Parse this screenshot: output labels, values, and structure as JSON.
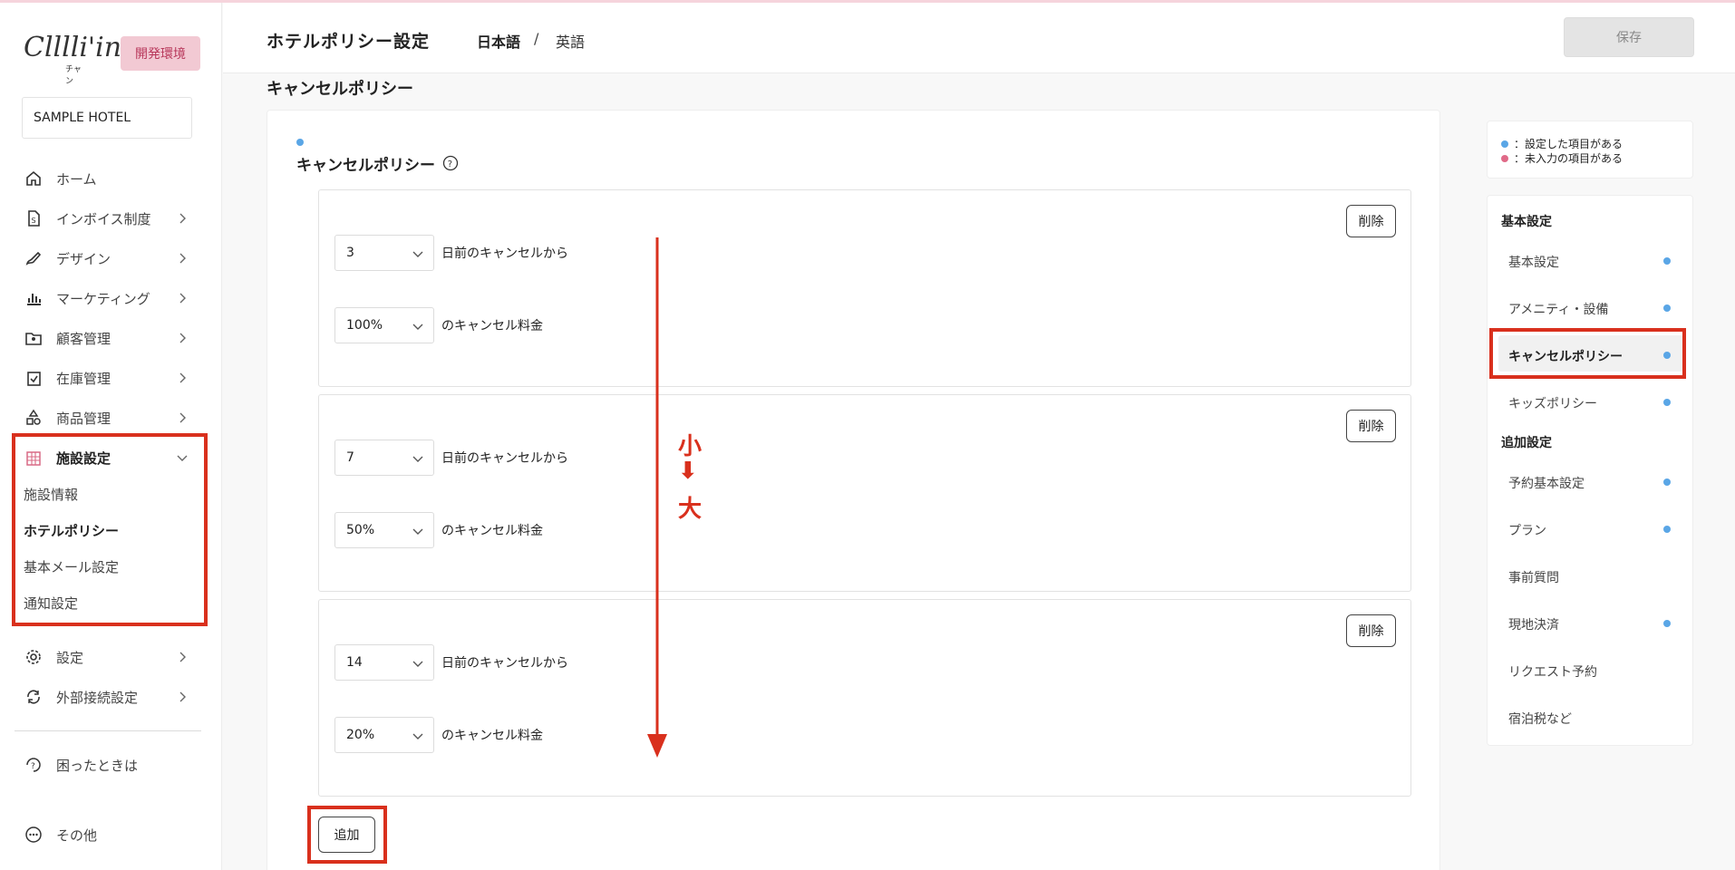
{
  "app": {
    "logo_sub": "チャン",
    "env_badge": "開発環境",
    "hotel_name": "SAMPLE HOTEL"
  },
  "sidebar": {
    "items": [
      {
        "label": "ホーム",
        "icon": "home-icon"
      },
      {
        "label": "インボイス制度",
        "icon": "invoice-icon"
      },
      {
        "label": "デザイン",
        "icon": "design-icon"
      },
      {
        "label": "マーケティング",
        "icon": "chart-icon"
      },
      {
        "label": "顧客管理",
        "icon": "customer-icon"
      },
      {
        "label": "在庫管理",
        "icon": "inventory-icon"
      },
      {
        "label": "商品管理",
        "icon": "product-icon"
      },
      {
        "label": "施設設定",
        "icon": "facility-icon"
      },
      {
        "label": "設定",
        "icon": "gear-icon"
      },
      {
        "label": "外部接続設定",
        "icon": "external-icon"
      }
    ],
    "facility_sub": [
      "施設情報",
      "ホテルポリシー",
      "基本メール設定",
      "通知設定"
    ],
    "help": "困ったときは",
    "other": "その他"
  },
  "header": {
    "title": "ホテルポリシー設定",
    "lang_ja": "日本語",
    "lang_sep": "/",
    "lang_en": "英語",
    "save": "保存"
  },
  "main": {
    "section_title": "キャンセルポリシー",
    "field_title": "キャンセルポリシー",
    "rules": [
      {
        "days": "3",
        "fee": "100%"
      },
      {
        "days": "7",
        "fee": "50%"
      },
      {
        "days": "14",
        "fee": "20%"
      }
    ],
    "days_suffix": "日前のキャンセルから",
    "fee_suffix": "のキャンセル料金",
    "delete_label": "削除",
    "add_label": "追加",
    "annotation": {
      "small": "小",
      "arrow": "⬇",
      "large": "大"
    }
  },
  "legend": {
    "set": "：設定した項目がある",
    "unset": "：未入力の項目がある",
    "set_color": "#5aa6e6",
    "unset_color": "#e06a88"
  },
  "right_nav": {
    "groups": [
      {
        "title": "基本設定",
        "items": [
          {
            "label": "基本設定",
            "dot": true
          },
          {
            "label": "アメニティ・設備",
            "dot": true
          },
          {
            "label": "キャンセルポリシー",
            "dot": true,
            "current": true
          },
          {
            "label": "キッズポリシー",
            "dot": true
          }
        ]
      },
      {
        "title": "追加設定",
        "items": [
          {
            "label": "予約基本設定",
            "dot": true
          },
          {
            "label": "プラン",
            "dot": true
          },
          {
            "label": "事前質問",
            "dot": false
          },
          {
            "label": "現地決済",
            "dot": true
          },
          {
            "label": "リクエスト予約",
            "dot": false
          },
          {
            "label": "宿泊税など",
            "dot": false
          }
        ]
      }
    ]
  },
  "colors": {
    "annotation_red": "#d9301d",
    "env_badge_bg": "#f2c9d3",
    "env_badge_text": "#b8385b"
  }
}
